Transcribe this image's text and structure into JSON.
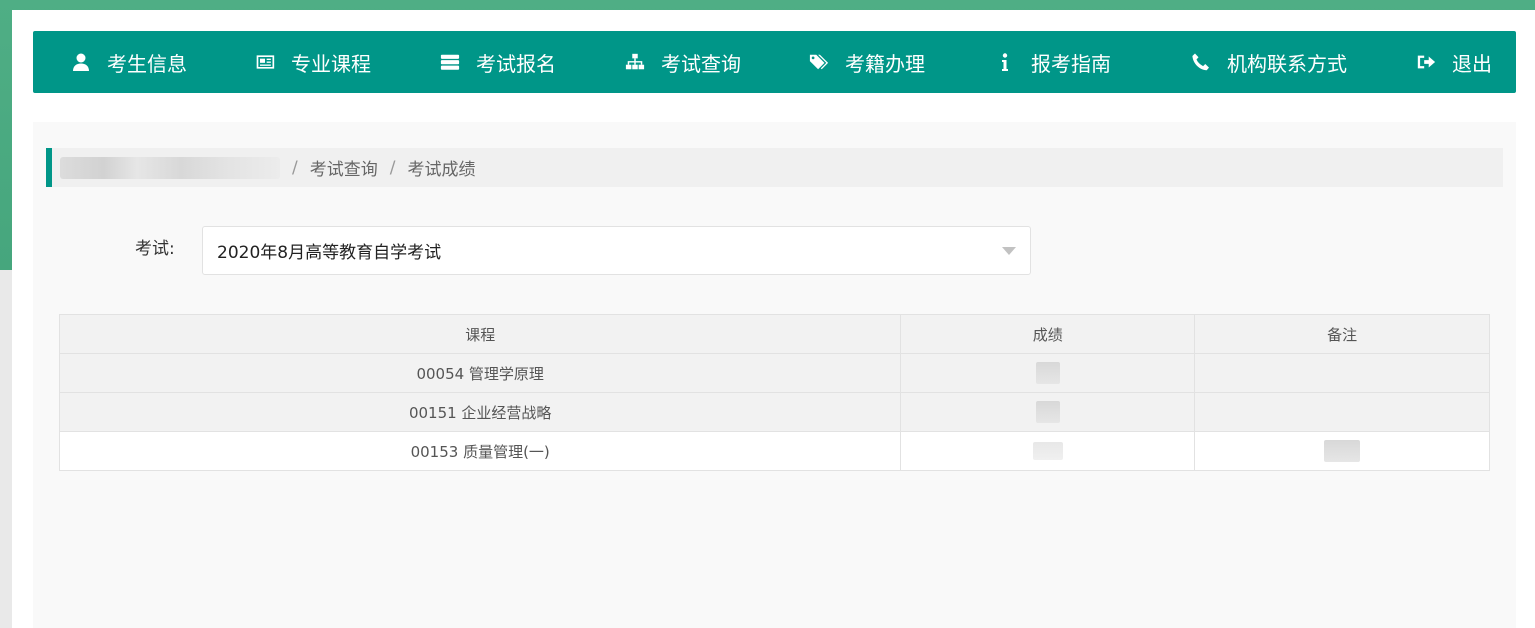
{
  "nav": {
    "items": [
      {
        "label": "考生信息",
        "icon": "user-icon"
      },
      {
        "label": "专业课程",
        "icon": "newspaper-icon"
      },
      {
        "label": "考试报名",
        "icon": "server-icon"
      },
      {
        "label": "考试查询",
        "icon": "sitemap-icon"
      },
      {
        "label": "考籍办理",
        "icon": "tags-icon"
      },
      {
        "label": "报考指南",
        "icon": "info-icon"
      },
      {
        "label": "机构联系方式",
        "icon": "phone-icon"
      },
      {
        "label": "退出",
        "icon": "sign-out-icon"
      }
    ],
    "bg_color": "#009688"
  },
  "breadcrumb": {
    "items": [
      "考试查询",
      "考试成绩"
    ],
    "separator": "/",
    "accent_color": "#009688"
  },
  "form": {
    "exam_label": "考试:",
    "exam_value": "2020年8月高等教育自学考试"
  },
  "table": {
    "headers": [
      "课程",
      "成绩",
      "备注"
    ],
    "rows": [
      {
        "course": "00054 管理学原理",
        "score": "",
        "remark": ""
      },
      {
        "course": "00151 企业经营战略",
        "score": "",
        "remark": ""
      },
      {
        "course": "00153 质量管理(一)",
        "score": "",
        "remark": ""
      }
    ]
  }
}
